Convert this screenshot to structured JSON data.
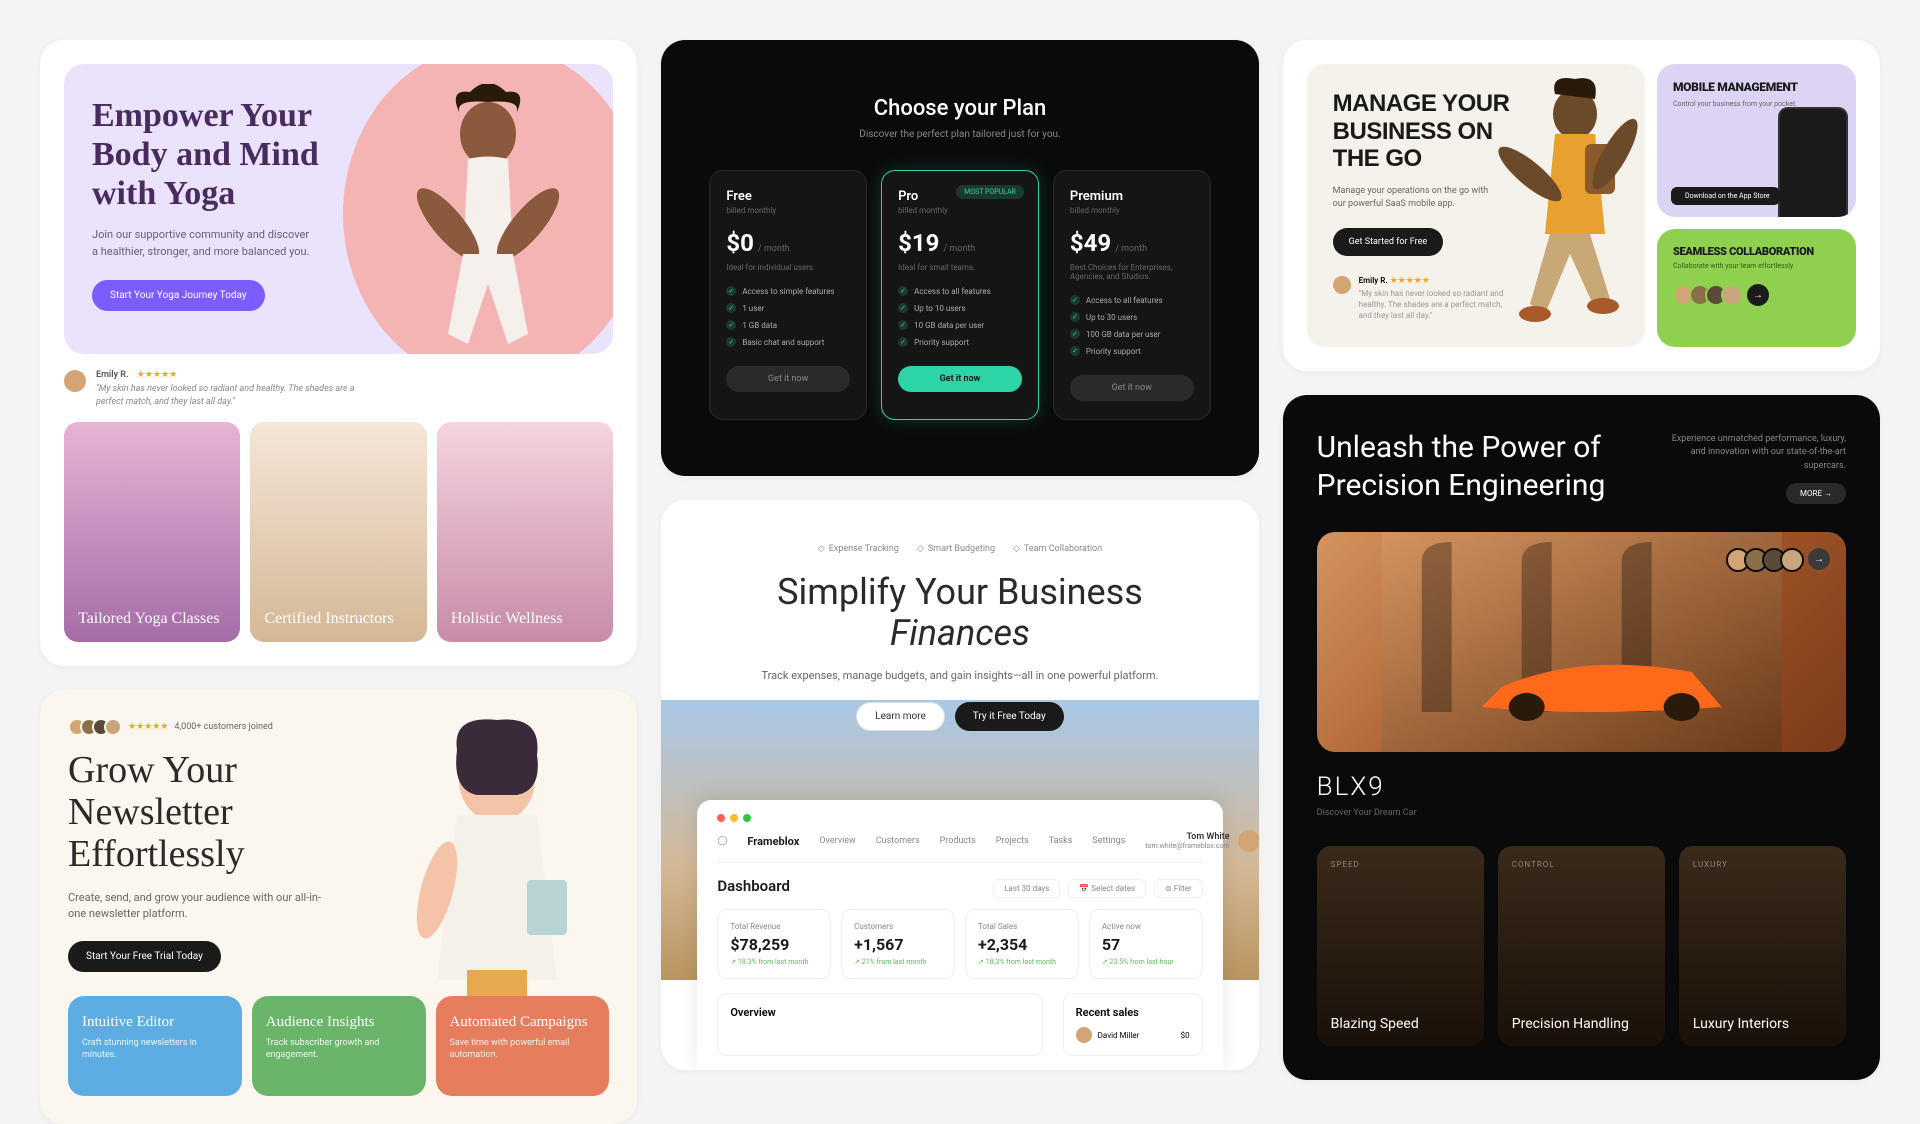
{
  "yoga": {
    "title": "Empower Your Body and Mind with Yoga",
    "subtitle": "Join our supportive community and discover a healthier, stronger, and more balanced you.",
    "cta": "Start Your Yoga Journey Today",
    "review": {
      "name": "Emily R.",
      "stars": "★★★★★",
      "text": "\"My skin has never looked so radiant and healthy. The shades are a perfect match, and they last all day.\""
    },
    "tiles": [
      "Tailored Yoga Classes",
      "Certified Instructors",
      "Holistic Wellness"
    ]
  },
  "newsletter": {
    "rating_stars": "★★★★★",
    "rating_label": "4,000+ customers joined",
    "title": "Grow Your Newsletter Effortlessly",
    "subtitle": "Create, send, and grow your audience with our all-in-one newsletter platform.",
    "cta": "Start Your Free Trial Today",
    "features": [
      {
        "title": "Intuitive Editor",
        "desc": "Craft stunning newsletters in minutes."
      },
      {
        "title": "Audience Insights",
        "desc": "Track subscriber growth and engagement."
      },
      {
        "title": "Automated Campaigns",
        "desc": "Save time with powerful email automation."
      }
    ]
  },
  "pricing": {
    "title": "Choose your Plan",
    "subtitle": "Discover the perfect plan tailored just for you.",
    "badge": "MOST POPULAR",
    "plans": [
      {
        "name": "Free",
        "period": "billed monthly",
        "price": "$0",
        "per": "/ month",
        "desc": "Ideal for individual users.",
        "feats": [
          "Access to simple features",
          "1 user",
          "1 GB data",
          "Basic chat and support"
        ],
        "btn": "Get it now"
      },
      {
        "name": "Pro",
        "period": "billed monthly",
        "price": "$19",
        "per": "/ month",
        "desc": "Ideal for small teams.",
        "feats": [
          "Access to all features",
          "Up to 10 users",
          "10 GB data per user",
          "Priority support"
        ],
        "btn": "Get it now"
      },
      {
        "name": "Premium",
        "period": "billed monthly",
        "price": "$49",
        "per": "/ month",
        "desc": "Best Choices for Enterprises, Agencies, and Studios.",
        "feats": [
          "Access to all features",
          "Up to 30 users",
          "100 GB data per user",
          "Priority support"
        ],
        "btn": "Get it now"
      }
    ]
  },
  "finance": {
    "tags": [
      "Expense Tracking",
      "Smart Budgeting",
      "Team Collaboration"
    ],
    "title_1": "Simplify Your Business",
    "title_2": "Finances",
    "subtitle": "Track expenses, manage budgets, and gain insights—all in one powerful platform.",
    "btn_sec": "Learn more",
    "btn_pri": "Try it Free Today",
    "dash": {
      "logo": "Frameblox",
      "nav": [
        "Overview",
        "Customers",
        "Products",
        "Projects",
        "Tasks",
        "Settings"
      ],
      "user": "Tom White",
      "email": "tom.white@frameblox.com",
      "title": "Dashboard",
      "filters": [
        "Last 30 days",
        "Select dates",
        "Filter"
      ],
      "stats": [
        {
          "label": "Total Revenue",
          "value": "$78,259",
          "delta": "↗ 19.3% from last month"
        },
        {
          "label": "Customers",
          "value": "+1,567",
          "delta": "↗ 21% from last month"
        },
        {
          "label": "Total Sales",
          "value": "+2,354",
          "delta": "↗ 18.3% from last month"
        },
        {
          "label": "Active now",
          "value": "57",
          "delta": "↗ 23.5% from last hour"
        }
      ],
      "overview": "Overview",
      "recent": "Recent sales",
      "recent_user": "David Miller",
      "recent_amt": "$0"
    }
  },
  "business": {
    "title": "MANAGE YOUR BUSINESS ON THE GO",
    "subtitle": "Manage your operations on the go with our powerful SaaS mobile app.",
    "cta": "Get Started for Free",
    "review": {
      "name": "Emily R.",
      "stars": "★★★★★",
      "text": "\"My skin has never looked so radiant and healthy. The shades are a perfect match, and they last all day.\""
    },
    "mobile": {
      "title": "MOBILE MANAGEMENT",
      "desc": "Control your business from your pocket.",
      "appstore": "Download on the App Store"
    },
    "collab": {
      "title": "SEAMLESS COLLABORATION",
      "desc": "Collaborate with your team effortlessly."
    }
  },
  "cars": {
    "title": "Unleash the Power of Precision Engineering",
    "subtitle": "Experience unmatched performance, luxury, and innovation with our state-of-the-art supercars.",
    "more": "MORE →",
    "model": "BLX9",
    "tagline": "Discover Your Dream Car",
    "features": [
      {
        "label": "SPEED",
        "title": "Blazing Speed"
      },
      {
        "label": "CONTROL",
        "title": "Precision Handling"
      },
      {
        "label": "LUXURY",
        "title": "Luxury Interiors"
      }
    ]
  }
}
